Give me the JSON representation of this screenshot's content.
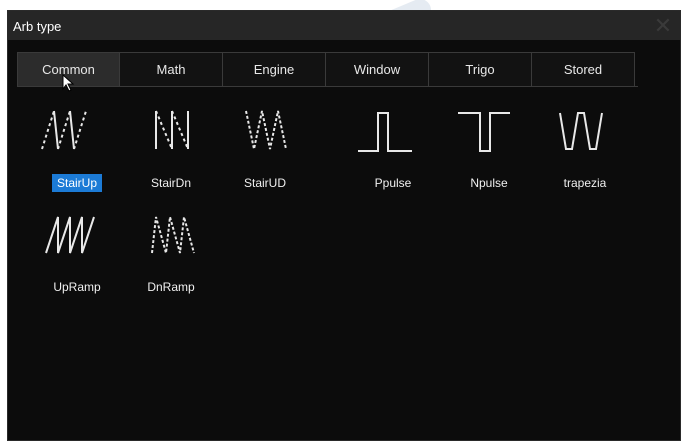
{
  "dialog": {
    "title": "Arb type",
    "close_icon": "close-icon"
  },
  "tabs": [
    {
      "label": "Common",
      "active": true
    },
    {
      "label": "Math",
      "active": false
    },
    {
      "label": "Engine",
      "active": false
    },
    {
      "label": "Window",
      "active": false
    },
    {
      "label": "Trigo",
      "active": false
    },
    {
      "label": "Stored",
      "active": false
    }
  ],
  "waveforms": [
    {
      "label": "StairUp",
      "icon": "stairup-icon",
      "selected": true
    },
    {
      "label": "StairDn",
      "icon": "stairdn-icon",
      "selected": false
    },
    {
      "label": "StairUD",
      "icon": "stairud-icon",
      "selected": false
    },
    {
      "label": "Ppulse",
      "icon": "ppulse-icon",
      "selected": false
    },
    {
      "label": "Npulse",
      "icon": "npulse-icon",
      "selected": false
    },
    {
      "label": "trapezia",
      "icon": "trapezia-icon",
      "selected": false
    },
    {
      "label": "UpRamp",
      "icon": "upramp-icon",
      "selected": false
    },
    {
      "label": "DnRamp",
      "icon": "dnramp-icon",
      "selected": false
    }
  ],
  "colors": {
    "selection": "#1c7bd6",
    "background": "#0c0c0c",
    "titlebar": "#262626"
  }
}
